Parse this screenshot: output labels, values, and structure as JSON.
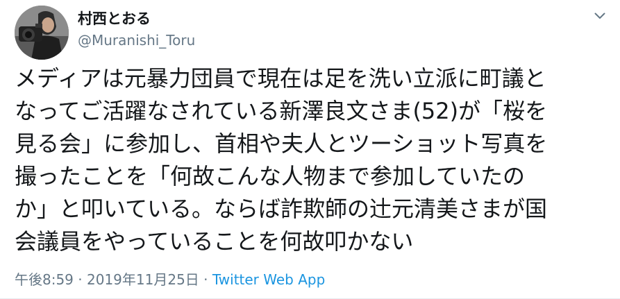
{
  "tweet": {
    "author": {
      "display_name": "村西とおる",
      "handle": "@Muranishi_Toru",
      "avatar_icon": "profile-photo"
    },
    "menu_icon": "chevron-down-icon",
    "text_lines": [
      "メディアは元暴力団員で現在は足を洗い立派に町議と",
      "なってご活躍なされている新澤良文さま(52)が「桜を",
      "見る会」に参加し、首相や夫人とツーショット写真を",
      "撮ったことを「何故こんな人物まで参加していたの",
      "か」と叩いている。ならば詐欺師の辻元清美さまが国",
      "会議員をやっていることを何故叩かない"
    ],
    "time": "午後8:59",
    "separator_1": " · ",
    "date": "2019年11月25日",
    "separator_2": " · ",
    "source": "Twitter Web App"
  },
  "colors": {
    "text": "#14171a",
    "secondary": "#657786",
    "link": "#1b95e0",
    "border": "#e6ecf0"
  }
}
